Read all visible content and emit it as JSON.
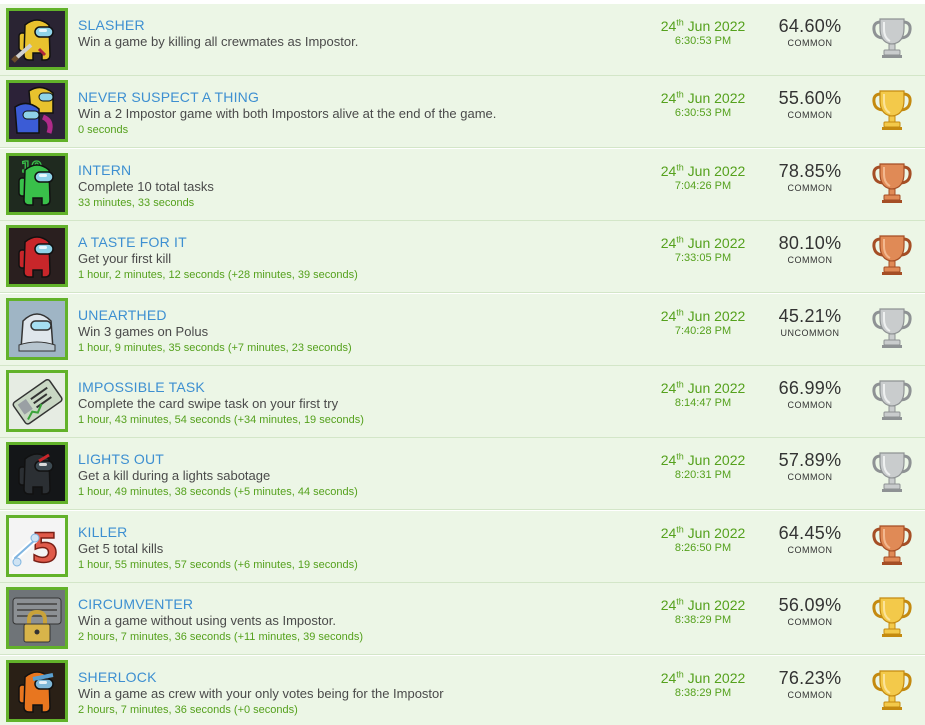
{
  "achievements": [
    {
      "title": "SLASHER",
      "desc": "Win a game by killing all crewmates as Impostor.",
      "elapsed": "",
      "day": "24",
      "suffix": "th",
      "monthyear": " Jun 2022",
      "time": "6:30:53 PM",
      "percent": "64.60%",
      "rarity": "COMMON",
      "trophy": "silver-trophy-icon",
      "icon": "impostor-knife-icon",
      "icon_color": "#e8c22e"
    },
    {
      "title": "NEVER SUSPECT A THING",
      "desc": "Win a 2 Impostor game with both Impostors alive at the end of the game.",
      "elapsed": "0 seconds",
      "day": "24",
      "suffix": "th",
      "monthyear": " Jun 2022",
      "time": "6:30:53 PM",
      "percent": "55.60%",
      "rarity": "COMMON",
      "trophy": "gold-trophy-icon",
      "icon": "two-impostors-icon",
      "icon_color": "#3b5cd6"
    },
    {
      "title": "INTERN",
      "desc": "Complete 10 total tasks",
      "elapsed": "33 minutes, 33 seconds",
      "day": "24",
      "suffix": "th",
      "monthyear": " Jun 2022",
      "time": "7:04:26 PM",
      "percent": "78.85%",
      "rarity": "COMMON",
      "trophy": "bronze-trophy-icon",
      "icon": "crewmate-ten-icon",
      "icon_color": "#39c04a"
    },
    {
      "title": "A TASTE FOR IT",
      "desc": "Get your first kill",
      "elapsed": "1 hour, 2 minutes, 12 seconds (+28 minutes, 39 seconds)",
      "day": "24",
      "suffix": "th",
      "monthyear": " Jun 2022",
      "time": "7:33:05 PM",
      "percent": "80.10%",
      "rarity": "COMMON",
      "trophy": "bronze-trophy-icon",
      "icon": "red-crewmate-icon",
      "icon_color": "#c8262a"
    },
    {
      "title": "UNEARTHED",
      "desc": "Win 3 games on Polus",
      "elapsed": "1 hour, 9 minutes, 35 seconds (+7 minutes, 23 seconds)",
      "day": "24",
      "suffix": "th",
      "monthyear": " Jun 2022",
      "time": "7:40:28 PM",
      "percent": "45.21%",
      "rarity": "UNCOMMON",
      "trophy": "silver-trophy-icon",
      "icon": "white-crewmate-icon",
      "icon_color": "#dfe6ec"
    },
    {
      "title": "IMPOSSIBLE TASK",
      "desc": "Complete the card swipe task on your first try",
      "elapsed": "1 hour, 43 minutes, 54 seconds (+34 minutes, 19 seconds)",
      "day": "24",
      "suffix": "th",
      "monthyear": " Jun 2022",
      "time": "8:14:47 PM",
      "percent": "66.99%",
      "rarity": "COMMON",
      "trophy": "silver-trophy-icon",
      "icon": "id-card-icon",
      "icon_color": "#c9d7c4"
    },
    {
      "title": "LIGHTS OUT",
      "desc": "Get a kill during a lights sabotage",
      "elapsed": "1 hour, 49 minutes, 38 seconds (+5 minutes, 44 seconds)",
      "day": "24",
      "suffix": "th",
      "monthyear": " Jun 2022",
      "time": "8:20:31 PM",
      "percent": "57.89%",
      "rarity": "COMMON",
      "trophy": "silver-trophy-icon",
      "icon": "dark-crewmate-icon",
      "icon_color": "#2b2f33"
    },
    {
      "title": "KILLER",
      "desc": "Get 5 total kills",
      "elapsed": "1 hour, 55 minutes, 57 seconds (+6 minutes, 19 seconds)",
      "day": "24",
      "suffix": "th",
      "monthyear": " Jun 2022",
      "time": "8:26:50 PM",
      "percent": "64.45%",
      "rarity": "COMMON",
      "trophy": "bronze-trophy-icon",
      "icon": "bone-five-icon",
      "icon_color": "#e05a4a"
    },
    {
      "title": "CIRCUMVENTER",
      "desc": "Win a game without using vents as Impostor.",
      "elapsed": "2 hours, 7 minutes, 36 seconds (+11 minutes, 39 seconds)",
      "day": "24",
      "suffix": "th",
      "monthyear": " Jun 2022",
      "time": "8:38:29 PM",
      "percent": "56.09%",
      "rarity": "COMMON",
      "trophy": "gold-trophy-icon",
      "icon": "locked-vent-icon",
      "icon_color": "#8c9094"
    },
    {
      "title": "SHERLOCK",
      "desc": "Win a game as crew with your only votes being for the Impostor",
      "elapsed": "2 hours, 7 minutes, 36 seconds (+0 seconds)",
      "day": "24",
      "suffix": "th",
      "monthyear": " Jun 2022",
      "time": "8:38:29 PM",
      "percent": "76.23%",
      "rarity": "COMMON",
      "trophy": "gold-trophy-icon",
      "icon": "orange-crewmate-icon",
      "icon_color": "#e8761f"
    }
  ],
  "colors": {
    "row_bg": "#ecf6e6",
    "title": "#3d8fd1",
    "green_text": "#55a11d",
    "icon_border": "#62b22a",
    "gold": "#e0a51a",
    "silver": "#a9acae",
    "bronze": "#c8673a"
  }
}
